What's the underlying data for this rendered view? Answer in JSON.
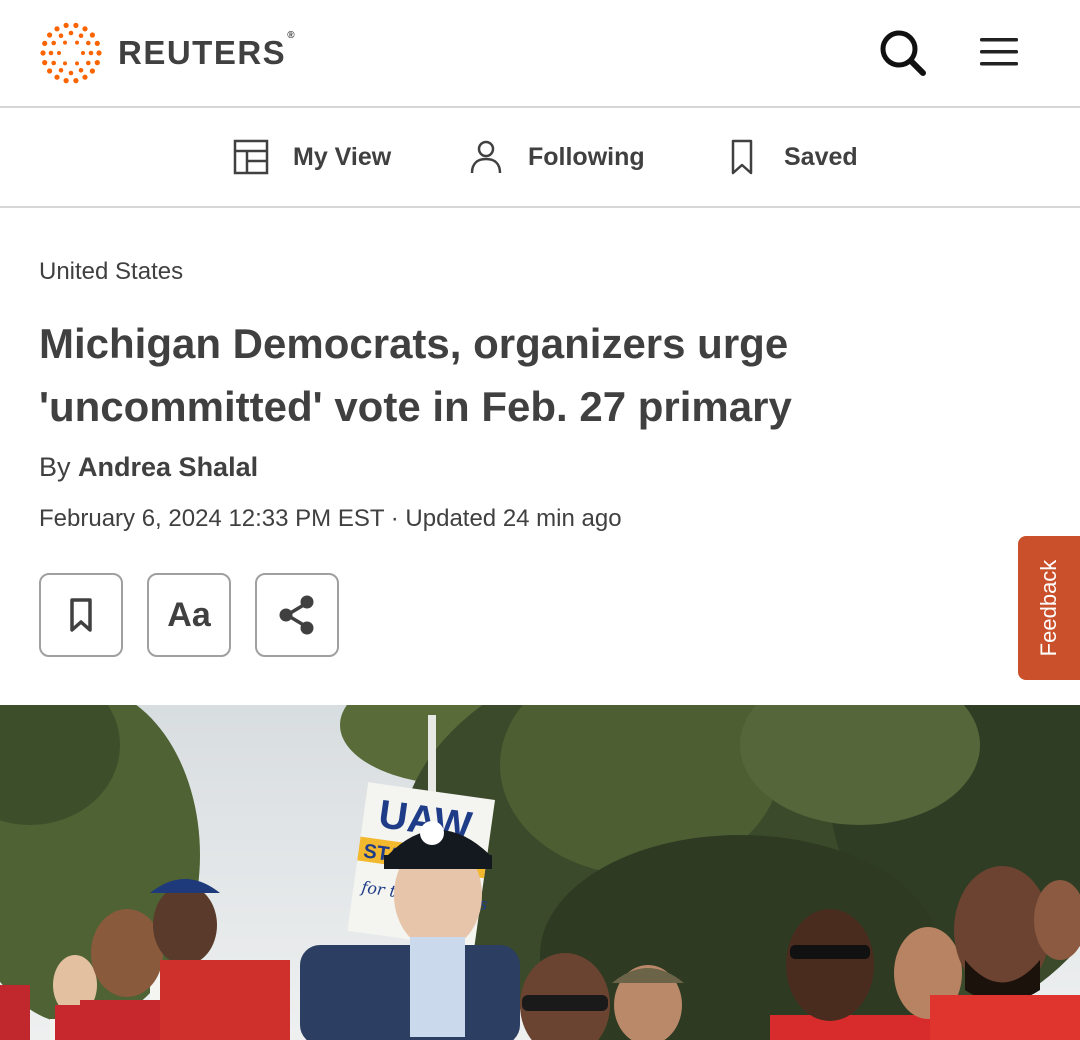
{
  "brand": {
    "name": "REUTERS",
    "reg": "®",
    "color": "#fa6400"
  },
  "header": {
    "search_icon": "search-icon",
    "menu_icon": "hamburger-menu-icon"
  },
  "subnav": {
    "items": [
      {
        "label": "My View",
        "icon": "layout-icon"
      },
      {
        "label": "Following",
        "icon": "person-icon"
      },
      {
        "label": "Saved",
        "icon": "bookmark-icon"
      }
    ]
  },
  "article": {
    "section": "United States",
    "headline": "Michigan Democrats, organizers urge 'uncommitted' vote in Feb. 27 primary",
    "byline_prefix": "By",
    "author": "Andrea Shalal",
    "dateline": "February 6, 2024 12:33 PM EST · Updated 24 min ago",
    "font_button_label": "Aa"
  },
  "feedback": {
    "label": "Feedback",
    "color": "#c9502a"
  },
  "photo": {
    "sign_text": "UAW",
    "sign_banner": "STA",
    "sign_note": "for the Workers"
  }
}
